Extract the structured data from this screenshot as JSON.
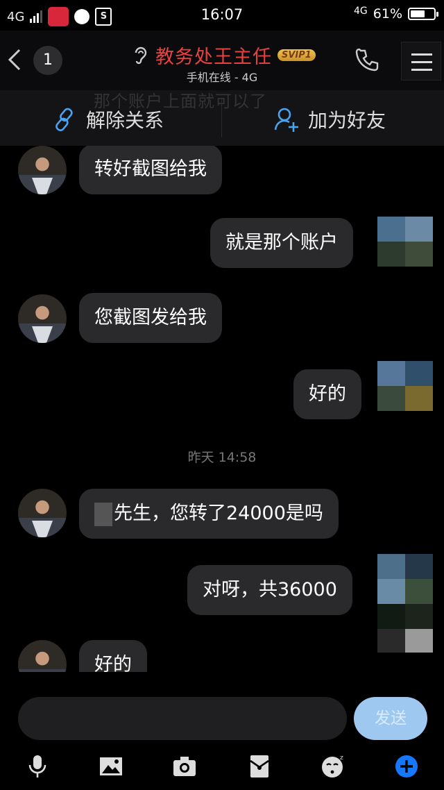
{
  "status_bar": {
    "signal_left": "4G",
    "time": "16:07",
    "signal_right": "4G",
    "battery_percent": "61%",
    "battery_level": 0.61
  },
  "header": {
    "unread_count": "1",
    "title": "教务处王主任",
    "badge": "SVIP1",
    "subtitle": "手机在线 - 4G"
  },
  "action_bar": {
    "ghost_text": "那个账户上面就可以了",
    "unlink_label": "解除关系",
    "add_friend_label": "加为好友"
  },
  "messages": [
    {
      "side": "left",
      "text": "转好截图给我"
    },
    {
      "side": "right",
      "text": "就是那个账户"
    },
    {
      "side": "left",
      "text": "您截图发给我"
    },
    {
      "side": "right",
      "text": "好的"
    },
    {
      "type": "timestamp",
      "text": "昨天 14:58"
    },
    {
      "side": "left",
      "text": "先生，您转了24000是吗"
    },
    {
      "side": "right",
      "text": "对呀，共36000"
    },
    {
      "side": "left",
      "text": "好的"
    }
  ],
  "input": {
    "value": "",
    "send_label": "发送"
  },
  "colors": {
    "title_red": "#e64340",
    "bubble_bg": "#2a2a2c",
    "send_blue": "#9ec8f0",
    "plus_blue": "#1677ff"
  },
  "toolbar_icons": [
    "microphone-icon",
    "image-icon",
    "camera-icon",
    "red-packet-icon",
    "emoji-icon",
    "plus-icon"
  ]
}
